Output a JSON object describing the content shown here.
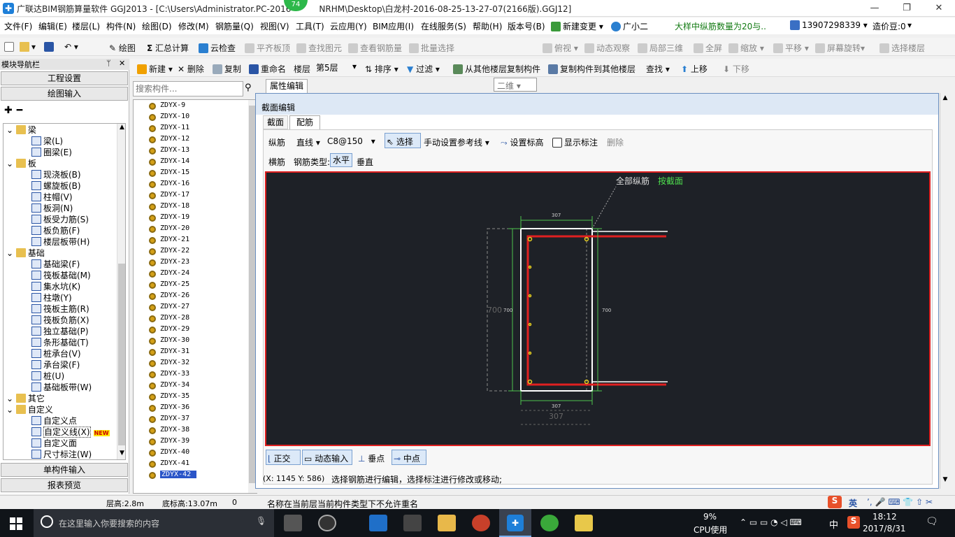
{
  "window": {
    "title": "广联达BIM钢筋算量软件 GGJ2013 - [C:\\Users\\Administrator.PC-2016",
    "title_tail": "NRHM\\Desktop\\白龙村-2016-08-25-13-27-07(2166版).GGJ12]",
    "badge": "74",
    "minimize": "—",
    "restore": "❐",
    "close": "✕"
  },
  "menu": [
    "文件(F)",
    "编辑(E)",
    "楼层(L)",
    "构件(N)",
    "绘图(D)",
    "修改(M)",
    "钢筋量(Q)",
    "视图(V)",
    "工具(T)",
    "云应用(Y)",
    "BIM应用(I)",
    "在线服务(S)",
    "帮助(H)",
    "版本号(B)",
    "新建变更",
    "广小二"
  ],
  "menu_notice": "大样中纵筋数量为20与..",
  "menu_phone": "13907298339",
  "menu_price": "造价豆:0",
  "toolbar1": {
    "draw": "绘图",
    "sum": "汇总计算",
    "cloud": "云检查",
    "align": "平齐板顶",
    "find": "查找图元",
    "viewsteel": "查看钢筋量",
    "batch": "批量选择",
    "view2d": "二维",
    "topview": "俯视",
    "dynamic": "动态观察",
    "local3d": "局部三维",
    "full": "全屏",
    "zoom": "缩放",
    "pan": "平移",
    "rotate": "屏幕旋转",
    "floorsel": "选择楼层"
  },
  "toolbar2": {
    "new": "新建",
    "delete": "删除",
    "copy": "复制",
    "rename": "重命名",
    "floor_label": "楼层",
    "floor_value": "第5层",
    "sort": "排序",
    "filter": "过滤",
    "copy_from": "从其他楼层复制构件",
    "copy_to": "复制构件到其他楼层",
    "find": "查找",
    "up": "上移",
    "down": "下移"
  },
  "nav": {
    "header": "模块导航栏",
    "pin": "ᛘ",
    "close": "✕",
    "project": "工程设置",
    "draw_input": "绘图输入",
    "single": "单构件输入",
    "report": "报表预览",
    "tree": [
      {
        "label": "梁",
        "level": 0,
        "folder": true
      },
      {
        "label": "梁(L)",
        "level": 1
      },
      {
        "label": "圈梁(E)",
        "level": 1
      },
      {
        "label": "板",
        "level": 0,
        "folder": true
      },
      {
        "label": "现浇板(B)",
        "level": 1
      },
      {
        "label": "螺旋板(B)",
        "level": 1
      },
      {
        "label": "柱帽(V)",
        "level": 1
      },
      {
        "label": "板洞(N)",
        "level": 1
      },
      {
        "label": "板受力筋(S)",
        "level": 1
      },
      {
        "label": "板负筋(F)",
        "level": 1
      },
      {
        "label": "楼层板带(H)",
        "level": 1
      },
      {
        "label": "基础",
        "level": 0,
        "folder": true
      },
      {
        "label": "基础梁(F)",
        "level": 1
      },
      {
        "label": "筏板基础(M)",
        "level": 1
      },
      {
        "label": "集水坑(K)",
        "level": 1
      },
      {
        "label": "柱墩(Y)",
        "level": 1
      },
      {
        "label": "筏板主筋(R)",
        "level": 1
      },
      {
        "label": "筏板负筋(X)",
        "level": 1
      },
      {
        "label": "独立基础(P)",
        "level": 1
      },
      {
        "label": "条形基础(T)",
        "level": 1
      },
      {
        "label": "桩承台(V)",
        "level": 1
      },
      {
        "label": "承台梁(F)",
        "level": 1
      },
      {
        "label": "桩(U)",
        "level": 1
      },
      {
        "label": "基础板带(W)",
        "level": 1
      },
      {
        "label": "其它",
        "level": 0,
        "folder": true
      },
      {
        "label": "自定义",
        "level": 0,
        "folder": true
      },
      {
        "label": "自定义点",
        "level": 1
      },
      {
        "label": "自定义线(X)",
        "level": 1
      },
      {
        "label": "自定义面",
        "level": 1
      },
      {
        "label": "尺寸标注(W)",
        "level": 1
      }
    ],
    "new_badge": "NEW"
  },
  "search": {
    "placeholder": "搜索构件..."
  },
  "components": [
    "ZDYX-9",
    "ZDYX-10",
    "ZDYX-11",
    "ZDYX-12",
    "ZDYX-13",
    "ZDYX-14",
    "ZDYX-15",
    "ZDYX-16",
    "ZDYX-17",
    "ZDYX-18",
    "ZDYX-19",
    "ZDYX-20",
    "ZDYX-21",
    "ZDYX-22",
    "ZDYX-23",
    "ZDYX-24",
    "ZDYX-25",
    "ZDYX-26",
    "ZDYX-27",
    "ZDYX-28",
    "ZDYX-29",
    "ZDYX-30",
    "ZDYX-31",
    "ZDYX-32",
    "ZDYX-33",
    "ZDYX-34",
    "ZDYX-35",
    "ZDYX-36",
    "ZDYX-37",
    "ZDYX-38",
    "ZDYX-39",
    "ZDYX-40",
    "ZDYX-41",
    "ZDYX-42"
  ],
  "selected_component": "ZDYX-42",
  "property_tab": "属性编辑",
  "editor": {
    "title": "截面编辑",
    "tab_section": "截面",
    "tab_rebar": "配筋",
    "longbar": "纵筋",
    "line": "直线",
    "spec": "C8@150",
    "select": "选择",
    "manual_ref": "手动设置参考线",
    "set_height": "设置标高",
    "show_label": "显示标注",
    "delete": "删除",
    "transbar": "横筋",
    "bar_type": "钢筋类型:",
    "horizontal": "水平",
    "vertical": "垂直",
    "ortho": "正交",
    "dyninput": "动态输入",
    "perp": "垂点",
    "mid": "中点",
    "coords": "(X: 1145 Y: 586)",
    "hint": "选择钢筋进行编辑，选择标注进行修改或移动;"
  },
  "drawing": {
    "label_all": "全部纵筋",
    "label_by": "按截面",
    "dim_top": "307",
    "dim_bottom": "307",
    "dim_bottom_outer": "307",
    "dim_left": "700",
    "dim_left_outer": "700",
    "dim_right": "700"
  },
  "status": {
    "floor_height": "层高:2.8m",
    "bottom_elev": "底标高:13.07m",
    "zero": "0",
    "message": "名称在当前层当前构件类型下不允许重名",
    "ime": "英"
  },
  "taskbar": {
    "search_text": "在这里输入你要搜索的内容",
    "cpu_pct": "9%",
    "cpu_label": "CPU使用",
    "lang": "中",
    "time": "18:12",
    "date": "2017/8/31"
  },
  "colors": {
    "accent": "#1e7fd8",
    "canvas": "#1e2127",
    "rebar": "#e02020",
    "dim": "#4ec24e"
  }
}
